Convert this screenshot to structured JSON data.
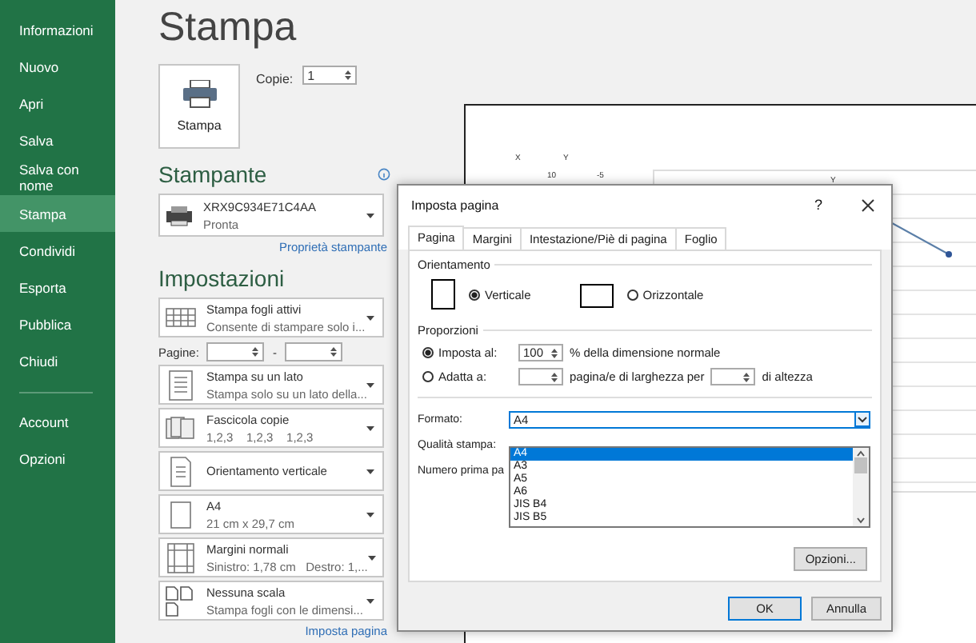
{
  "sidebar": {
    "items": [
      {
        "label": "Informazioni",
        "selected": false
      },
      {
        "label": "Nuovo",
        "selected": false
      },
      {
        "label": "Apri",
        "selected": false
      },
      {
        "label": "Salva",
        "selected": false
      },
      {
        "label": "Salva con nome",
        "selected": false
      },
      {
        "label": "Stampa",
        "selected": true
      },
      {
        "label": "Condividi",
        "selected": false
      },
      {
        "label": "Esporta",
        "selected": false
      },
      {
        "label": "Pubblica",
        "selected": false
      },
      {
        "label": "Chiudi",
        "selected": false
      }
    ],
    "bottom_items": [
      {
        "label": "Account",
        "selected": false
      },
      {
        "label": "Opzioni",
        "selected": false
      }
    ]
  },
  "print": {
    "title": "Stampa",
    "button": "Stampa",
    "copies_label": "Copie:",
    "copies_value": "1"
  },
  "printer": {
    "heading": "Stampante",
    "name": "XRX9C934E71C4AA",
    "status": "Pronta",
    "link": "Proprietà stampante"
  },
  "settings": {
    "heading": "Impostazioni",
    "items": [
      {
        "kind": "sheets",
        "title": "Stampa fogli attivi",
        "subtitle": "Consente di stampare solo i..."
      },
      {
        "kind": "pages",
        "label": "Pagine:",
        "separator": "-"
      },
      {
        "kind": "sides",
        "title": "Stampa su un lato",
        "subtitle": "Stampa solo su un lato della..."
      },
      {
        "kind": "collate",
        "title": "Fascicola copie",
        "subtitle": "1,2,3    1,2,3    1,2,3"
      },
      {
        "kind": "orientation",
        "title": "Orientamento verticale"
      },
      {
        "kind": "paper",
        "title": "A4",
        "subtitle": "21 cm x 29,7 cm"
      },
      {
        "kind": "margins",
        "title": "Margini normali",
        "subtitle": "Sinistro: 1,78 cm   Destro: 1,..."
      },
      {
        "kind": "scaling",
        "title": "Nessuna scala",
        "subtitle": "Stampa fogli con le dimensi..."
      }
    ],
    "link": "Imposta pagina"
  },
  "preview": {
    "cells": [
      "X",
      "Y",
      "10",
      "-5"
    ],
    "chart_title": "Y"
  },
  "dialog": {
    "title": "Imposta pagina",
    "help": "?",
    "tabs": [
      {
        "label": "Pagina",
        "selected": true
      },
      {
        "label": "Margini",
        "selected": false
      },
      {
        "label": "Intestazione/Piè di pagina",
        "selected": false
      },
      {
        "label": "Foglio",
        "selected": false
      }
    ],
    "orientation": {
      "heading": "Orientamento",
      "options": [
        {
          "kind": "portrait",
          "label": "Verticale",
          "selected": true
        },
        {
          "kind": "landscape",
          "label": "Orizzontale",
          "selected": false
        }
      ]
    },
    "scaling": {
      "heading": "Proporzioni",
      "adjust": {
        "label": "Imposta al:",
        "selected": true,
        "value": "100",
        "suffix": "% della dimensione normale"
      },
      "fit": {
        "label": "Adatta a:",
        "selected": false,
        "middle": "pagina/e di larghezza per",
        "suffix": "di altezza"
      }
    },
    "format": {
      "label": "Formato:",
      "value": "A4",
      "options": [
        {
          "label": "A4",
          "selected": true
        },
        {
          "label": "A3",
          "selected": false
        },
        {
          "label": "A5",
          "selected": false
        },
        {
          "label": "A6",
          "selected": false
        },
        {
          "label": "JIS B4",
          "selected": false
        },
        {
          "label": "JIS B5",
          "selected": false
        }
      ]
    },
    "quality_label": "Qualità stampa:",
    "first_page_label": "Numero prima pa",
    "options_button": "Opzioni...",
    "buttons": [
      {
        "label": "OK",
        "kind": "default"
      },
      {
        "label": "Annulla",
        "kind": "normal"
      }
    ]
  }
}
